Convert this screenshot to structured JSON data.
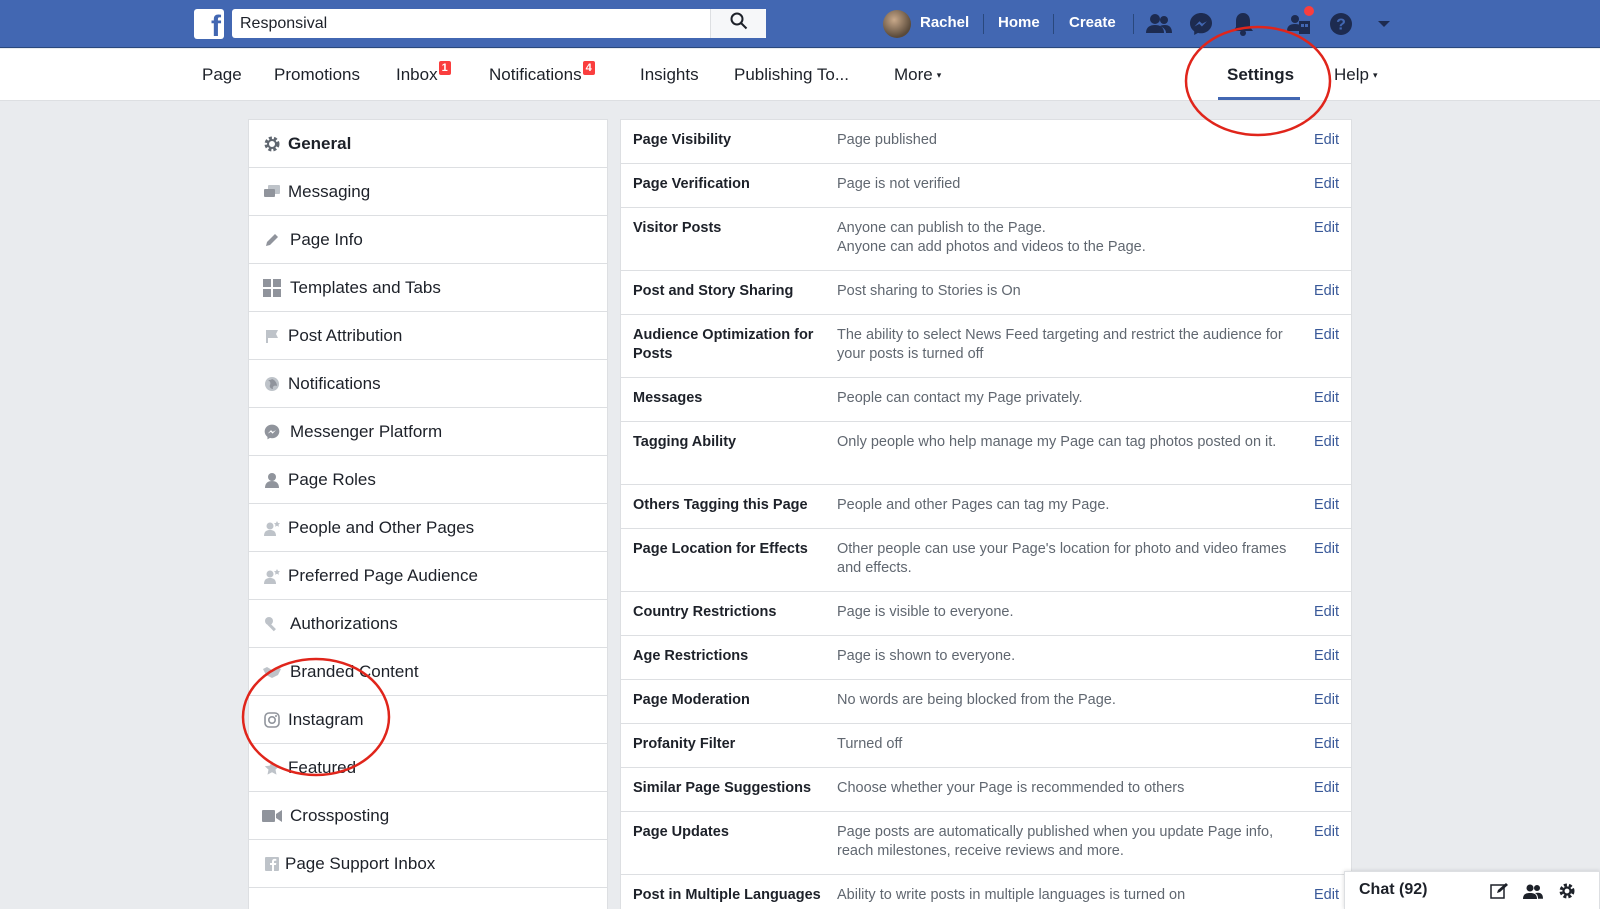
{
  "topbar": {
    "brand_letter": "f",
    "search_value": "Responsival",
    "user_name": "Rachel",
    "links": [
      "Home",
      "Create"
    ],
    "icons": [
      "friends-icon",
      "messenger-icon",
      "notifications-bell-icon",
      "pages-icon",
      "help-icon",
      "account-caret-icon"
    ],
    "brand_color": "#4267b2"
  },
  "subnav": {
    "items": [
      {
        "label": "Page"
      },
      {
        "label": "Promotions"
      },
      {
        "label": "Inbox",
        "badge": "1"
      },
      {
        "label": "Notifications",
        "badge": "4"
      },
      {
        "label": "Insights"
      },
      {
        "label": "Publishing To..."
      },
      {
        "label": "More",
        "caret": "▾"
      },
      {
        "label": "Settings",
        "active": true
      },
      {
        "label": "Help",
        "caret": "▾"
      }
    ]
  },
  "left_menu": {
    "items": [
      {
        "label": "General",
        "icon": "gear-icon",
        "active": true
      },
      {
        "label": "Messaging",
        "icon": "messaging-icon"
      },
      {
        "label": "Page Info",
        "icon": "pencil-icon"
      },
      {
        "label": "Templates and Tabs",
        "icon": "grid-icon"
      },
      {
        "label": "Post Attribution",
        "icon": "flag-icon"
      },
      {
        "label": "Notifications",
        "icon": "globe-icon"
      },
      {
        "label": "Messenger Platform",
        "icon": "messenger-icon"
      },
      {
        "label": "Page Roles",
        "icon": "person-icon"
      },
      {
        "label": "People and Other Pages",
        "icon": "person-star-icon"
      },
      {
        "label": "Preferred Page Audience",
        "icon": "person-star-icon"
      },
      {
        "label": "Authorizations",
        "icon": "wrench-icon"
      },
      {
        "label": "Branded Content",
        "icon": "handshake-icon"
      },
      {
        "label": "Instagram",
        "icon": "instagram-icon"
      },
      {
        "label": "Featured",
        "icon": "star-icon"
      },
      {
        "label": "Crossposting",
        "icon": "video-camera-icon"
      },
      {
        "label": "Page Support Inbox",
        "icon": "facebook-square-icon"
      }
    ]
  },
  "settings": {
    "edit_label": "Edit",
    "rows": [
      {
        "title": "Page Visibility",
        "value": "Page published"
      },
      {
        "title": "Page Verification",
        "value": "Page is not verified"
      },
      {
        "title": "Visitor Posts",
        "value": "Anyone can publish to the Page.\nAnyone can add photos and videos to the Page."
      },
      {
        "title": "Post and Story Sharing",
        "value": "Post sharing to Stories is On"
      },
      {
        "title": "Audience Optimization for Posts",
        "value": "The ability to select News Feed targeting and restrict the audience for your posts is turned off"
      },
      {
        "title": "Messages",
        "value": "People can contact my Page privately."
      },
      {
        "title": "Tagging Ability",
        "value": "Only people who help manage my Page can tag photos posted on it."
      },
      {
        "title": "Others Tagging this Page",
        "value": "People and other Pages can tag my Page."
      },
      {
        "title": "Page Location for Effects",
        "value": "Other people can use your Page's location for photo and video frames and effects."
      },
      {
        "title": "Country Restrictions",
        "value": "Page is visible to everyone."
      },
      {
        "title": "Age Restrictions",
        "value": "Page is shown to everyone."
      },
      {
        "title": "Page Moderation",
        "value": "No words are being blocked from the Page."
      },
      {
        "title": "Profanity Filter",
        "value": "Turned off"
      },
      {
        "title": "Similar Page Suggestions",
        "value": "Choose whether your Page is recommended to others"
      },
      {
        "title": "Page Updates",
        "value": "Page posts are automatically published when you update Page info, reach milestones, receive reviews and more."
      },
      {
        "title": "Post in Multiple Languages",
        "value": "Ability to write posts in multiple languages is turned on"
      }
    ]
  },
  "chat": {
    "label": "Chat (92)",
    "icons": [
      "compose-icon",
      "group-icon",
      "gear-icon"
    ]
  },
  "annotation_color": "#e0251b"
}
